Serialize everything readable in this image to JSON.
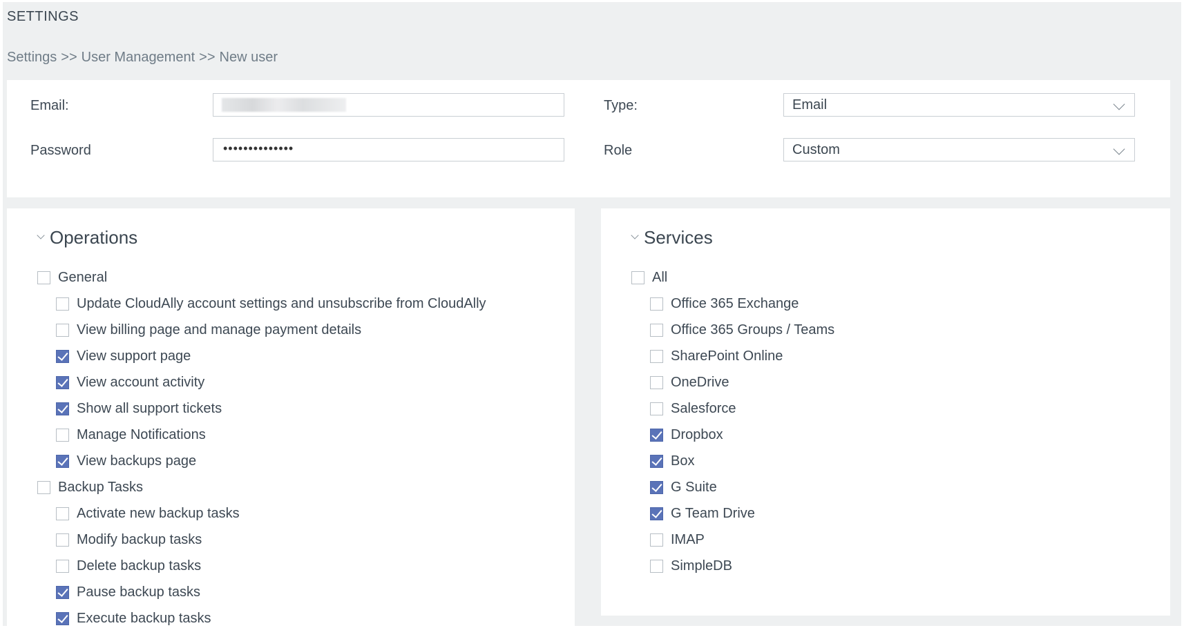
{
  "header": {
    "title": "SETTINGS",
    "breadcrumb": [
      "Settings",
      ">>",
      "User Management",
      ">>",
      "New user"
    ]
  },
  "form": {
    "email_label": "Email:",
    "email_value": "",
    "password_label": "Password",
    "password_value": "••••••••••••••",
    "type_label": "Type:",
    "type_value": "Email",
    "role_label": "Role",
    "role_value": "Custom"
  },
  "operations": {
    "title": "Operations",
    "items": [
      {
        "label": "General",
        "checked": false,
        "level": 0
      },
      {
        "label": "Update CloudAlly account settings and unsubscribe from CloudAlly",
        "checked": false,
        "level": 1
      },
      {
        "label": "View billing page and manage payment details",
        "checked": false,
        "level": 1
      },
      {
        "label": "View support page",
        "checked": true,
        "level": 1
      },
      {
        "label": "View account activity",
        "checked": true,
        "level": 1
      },
      {
        "label": "Show all support tickets",
        "checked": true,
        "level": 1
      },
      {
        "label": "Manage Notifications",
        "checked": false,
        "level": 1
      },
      {
        "label": "View backups page",
        "checked": true,
        "level": 1
      },
      {
        "label": "Backup Tasks",
        "checked": false,
        "level": 0
      },
      {
        "label": "Activate new backup tasks",
        "checked": false,
        "level": 1
      },
      {
        "label": "Modify backup tasks",
        "checked": false,
        "level": 1
      },
      {
        "label": "Delete backup tasks",
        "checked": false,
        "level": 1
      },
      {
        "label": "Pause backup tasks",
        "checked": true,
        "level": 1
      },
      {
        "label": "Execute backup tasks",
        "checked": true,
        "level": 1
      }
    ]
  },
  "services": {
    "title": "Services",
    "items": [
      {
        "label": "All",
        "checked": false,
        "level": 0
      },
      {
        "label": "Office 365 Exchange",
        "checked": false,
        "level": 1
      },
      {
        "label": "Office 365 Groups / Teams",
        "checked": false,
        "level": 1
      },
      {
        "label": "SharePoint Online",
        "checked": false,
        "level": 1
      },
      {
        "label": "OneDrive",
        "checked": false,
        "level": 1
      },
      {
        "label": "Salesforce",
        "checked": false,
        "level": 1
      },
      {
        "label": "Dropbox",
        "checked": true,
        "level": 1
      },
      {
        "label": "Box",
        "checked": true,
        "level": 1
      },
      {
        "label": "G Suite",
        "checked": true,
        "level": 1
      },
      {
        "label": "G Team Drive",
        "checked": true,
        "level": 1
      },
      {
        "label": "IMAP",
        "checked": false,
        "level": 1
      },
      {
        "label": "SimpleDB",
        "checked": false,
        "level": 1
      }
    ]
  },
  "colors": {
    "checkbox_checked": "#5a73b8",
    "page_background": "#eef0f1"
  }
}
